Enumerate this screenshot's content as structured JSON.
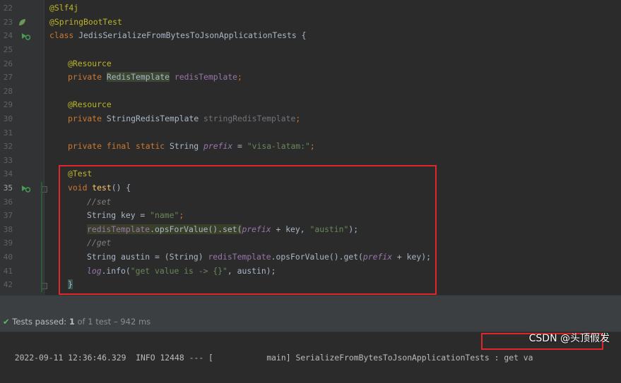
{
  "editor": {
    "line_numbers": [
      "22",
      "23",
      "24",
      "25",
      "26",
      "27",
      "28",
      "29",
      "30",
      "31",
      "32",
      "33",
      "34",
      "35",
      "36",
      "37",
      "38",
      "39",
      "40",
      "41",
      "42"
    ],
    "lines": {
      "l22": {
        "annotation": "@Slf4j"
      },
      "l23": {
        "annotation": "@SpringBootTest"
      },
      "l24": {
        "kw": "class",
        "name": "JedisSerializeFromBytesToJsonApplicationTests {"
      },
      "l26": {
        "annotation": "@Resource"
      },
      "l27": {
        "kw": "private",
        "type": "RedisTemplate",
        "field": "redisTemplate",
        "end": ";"
      },
      "l29": {
        "annotation": "@Resource"
      },
      "l30": {
        "kw": "private",
        "type": "StringRedisTemplate",
        "field": "stringRedisTemplate",
        "end": ";"
      },
      "l32": {
        "kw": "private final static",
        "type": "String",
        "field": "prefix",
        "eq": " = ",
        "value": "\"visa-latam:\"",
        "end": ";"
      },
      "l34": {
        "annotation": "@Test"
      },
      "l35": {
        "kw": "void",
        "method": "test",
        "rest": "() {"
      },
      "l36": {
        "comment": "//set"
      },
      "l37": {
        "pre": "String key = ",
        "value": "\"name\"",
        "end": ";"
      },
      "l38": {
        "field": "redisTemplate",
        "call": ".opsForValue().set(",
        "sfield": "prefix",
        "mid": " + key, ",
        "value": "\"austin\"",
        "end": ");"
      },
      "l39": {
        "comment": "//get"
      },
      "l40": {
        "pre": "String austin = (String) ",
        "field": "redisTemplate",
        "call": ".opsForValue().get(",
        "sfield": "prefix",
        "end": " + key);"
      },
      "l41": {
        "sfield": "log",
        "call": ".info(",
        "value": "\"get value is -> {}\"",
        "end": ", austin);"
      },
      "l42": {
        "brace": "}"
      }
    }
  },
  "tests_bar": {
    "status": "Tests passed:",
    "count": "1",
    "detail": "of 1 test – 942 ms"
  },
  "console": {
    "line": "2022-09-11 12:36:46.329  INFO 12448 --- [           main] SerializeFromBytesToJsonApplicationTests : get va"
  },
  "watermark": "CSDN @头顶假发",
  "colors": {
    "background": "#2b2b2b",
    "gutter": "#313335",
    "highlight_box": "#e0262c",
    "annotation": "#bbb529",
    "keyword": "#cc7832",
    "string": "#6a8759"
  }
}
